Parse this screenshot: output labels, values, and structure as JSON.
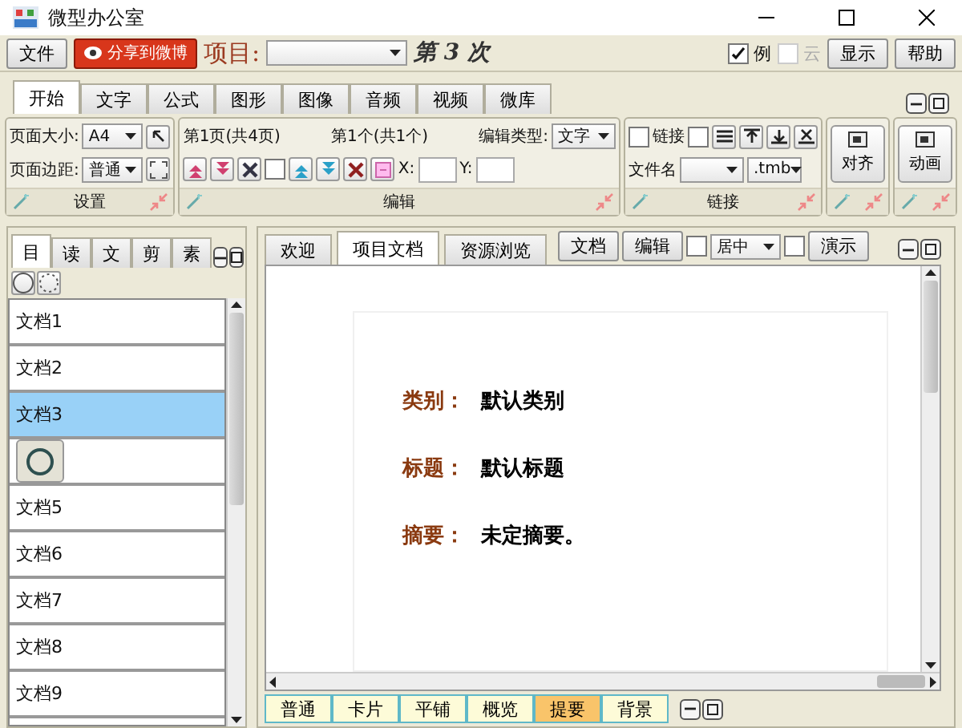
{
  "window": {
    "title": "微型办公室"
  },
  "toolbar": {
    "file": "文件",
    "share": "分享到微博",
    "project_label": "项目:",
    "count": "第 3 次",
    "checks": [
      {
        "label": "例",
        "checked": true,
        "disabled": false
      },
      {
        "label": "云",
        "checked": false,
        "disabled": true
      }
    ],
    "buttons": [
      "显示",
      "帮助"
    ]
  },
  "ribbon_tabs": [
    {
      "label": "开始",
      "selected": true
    },
    {
      "label": "文字",
      "selected": false
    },
    {
      "label": "公式",
      "selected": false
    },
    {
      "label": "图形",
      "selected": false
    },
    {
      "label": "图像",
      "selected": false
    },
    {
      "label": "音频",
      "selected": false
    },
    {
      "label": "视频",
      "selected": false
    },
    {
      "label": "微库",
      "selected": false
    }
  ],
  "ribbon": {
    "settings": {
      "page_size_label": "页面大小:",
      "page_size": "A4",
      "margin_label": "页面边距:",
      "margin": "普通",
      "title": "设置"
    },
    "edit": {
      "page_info": "第1页(共4页)",
      "item_info": "第1个(共1个)",
      "edit_type_label": "编辑类型:",
      "edit_type": "文字",
      "checked": false,
      "x_label": "X:",
      "y_label": "Y:",
      "title": "编辑"
    },
    "link": {
      "link_label": "链接",
      "link_checked": false,
      "extra_checked": false,
      "filename_label": "文件名",
      "extension": ".tmb",
      "title": "链接"
    },
    "big_buttons": [
      "对齐",
      "动画"
    ]
  },
  "left_panel": {
    "tabs": [
      {
        "label": "目",
        "selected": true
      },
      {
        "label": "读",
        "selected": false
      },
      {
        "label": "文",
        "selected": false
      },
      {
        "label": "剪",
        "selected": false
      },
      {
        "label": "素",
        "selected": false
      }
    ],
    "documents": [
      {
        "label": "文档1",
        "selected": false
      },
      {
        "label": "文档2",
        "selected": false
      },
      {
        "label": "文档3",
        "selected": true
      },
      {
        "selected": false
      },
      {
        "label": "文档5",
        "selected": false
      },
      {
        "label": "文档6",
        "selected": false
      },
      {
        "label": "文档7",
        "selected": false
      },
      {
        "label": "文档8",
        "selected": false
      },
      {
        "label": "文档9",
        "selected": false
      }
    ]
  },
  "right_panel": {
    "tabs": [
      {
        "label": "欢迎",
        "selected": false
      },
      {
        "label": "项目文档",
        "selected": true
      },
      {
        "label": "资源浏览",
        "selected": false
      }
    ],
    "buttons": [
      "文档",
      "编辑"
    ],
    "check_1": false,
    "align": "居中",
    "check_2": false,
    "present": "演示",
    "document": [
      {
        "label": "类别：",
        "value": "默认类别"
      },
      {
        "label": "标题：",
        "value": "默认标题"
      },
      {
        "label": "摘要：",
        "value": "未定摘要。"
      }
    ],
    "view_tabs": [
      {
        "label": "普通",
        "selected": false
      },
      {
        "label": "卡片",
        "selected": false
      },
      {
        "label": "平铺",
        "selected": false
      },
      {
        "label": "概览",
        "selected": false
      },
      {
        "label": "提要",
        "selected": true
      },
      {
        "label": "背景",
        "selected": false
      }
    ]
  }
}
